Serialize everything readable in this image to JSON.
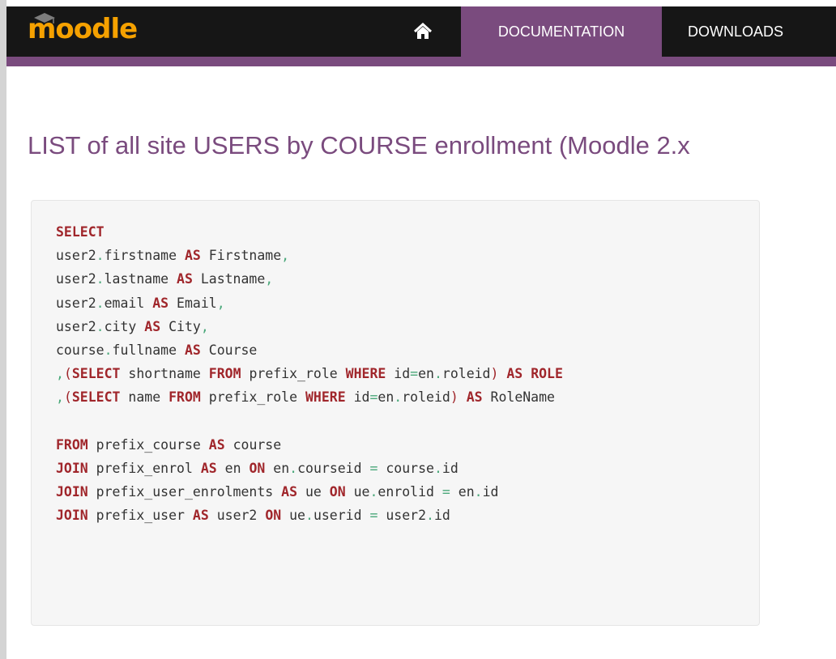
{
  "header": {
    "logo_text": "moodle",
    "nav": {
      "home_icon": "home-icon",
      "items": [
        {
          "label": "DOCUMENTATION",
          "active": true
        },
        {
          "label": "DOWNLOADS",
          "active": false
        }
      ]
    },
    "colors": {
      "bar": "#161616",
      "accent": "#7a4b7e",
      "logo": "#f5a100"
    }
  },
  "main": {
    "title": "LIST of all site USERS by COURSE enrollment (Moodle 2.x"
  },
  "code": {
    "language": "sql",
    "lines": [
      [
        {
          "t": "kw",
          "v": "SELECT"
        }
      ],
      [
        {
          "t": "tx",
          "v": "user2"
        },
        {
          "t": "pn",
          "v": "."
        },
        {
          "t": "tx",
          "v": "firstname "
        },
        {
          "t": "kw",
          "v": "AS"
        },
        {
          "t": "tx",
          "v": " Firstname"
        },
        {
          "t": "pn",
          "v": ","
        }
      ],
      [
        {
          "t": "tx",
          "v": "user2"
        },
        {
          "t": "pn",
          "v": "."
        },
        {
          "t": "tx",
          "v": "lastname "
        },
        {
          "t": "kw",
          "v": "AS"
        },
        {
          "t": "tx",
          "v": " Lastname"
        },
        {
          "t": "pn",
          "v": ","
        }
      ],
      [
        {
          "t": "tx",
          "v": "user2"
        },
        {
          "t": "pn",
          "v": "."
        },
        {
          "t": "tx",
          "v": "email "
        },
        {
          "t": "kw",
          "v": "AS"
        },
        {
          "t": "tx",
          "v": " Email"
        },
        {
          "t": "pn",
          "v": ","
        }
      ],
      [
        {
          "t": "tx",
          "v": "user2"
        },
        {
          "t": "pn",
          "v": "."
        },
        {
          "t": "tx",
          "v": "city "
        },
        {
          "t": "kw",
          "v": "AS"
        },
        {
          "t": "tx",
          "v": " City"
        },
        {
          "t": "pn",
          "v": ","
        }
      ],
      [
        {
          "t": "tx",
          "v": "course"
        },
        {
          "t": "pn",
          "v": "."
        },
        {
          "t": "tx",
          "v": "fullname "
        },
        {
          "t": "kw",
          "v": "AS"
        },
        {
          "t": "tx",
          "v": " Course"
        }
      ],
      [
        {
          "t": "pn",
          "v": ","
        },
        {
          "t": "pr",
          "v": "("
        },
        {
          "t": "kw",
          "v": "SELECT"
        },
        {
          "t": "tx",
          "v": " shortname "
        },
        {
          "t": "kw",
          "v": "FROM"
        },
        {
          "t": "tx",
          "v": " prefix_role "
        },
        {
          "t": "kw",
          "v": "WHERE"
        },
        {
          "t": "tx",
          "v": " id"
        },
        {
          "t": "pn",
          "v": "="
        },
        {
          "t": "tx",
          "v": "en"
        },
        {
          "t": "pn",
          "v": "."
        },
        {
          "t": "tx",
          "v": "roleid"
        },
        {
          "t": "pr",
          "v": ")"
        },
        {
          "t": "tx",
          "v": " "
        },
        {
          "t": "kw",
          "v": "AS"
        },
        {
          "t": "tx",
          "v": " "
        },
        {
          "t": "kw",
          "v": "ROLE"
        }
      ],
      [
        {
          "t": "pn",
          "v": ","
        },
        {
          "t": "pr",
          "v": "("
        },
        {
          "t": "kw",
          "v": "SELECT"
        },
        {
          "t": "tx",
          "v": " name "
        },
        {
          "t": "kw",
          "v": "FROM"
        },
        {
          "t": "tx",
          "v": " prefix_role "
        },
        {
          "t": "kw",
          "v": "WHERE"
        },
        {
          "t": "tx",
          "v": " id"
        },
        {
          "t": "pn",
          "v": "="
        },
        {
          "t": "tx",
          "v": "en"
        },
        {
          "t": "pn",
          "v": "."
        },
        {
          "t": "tx",
          "v": "roleid"
        },
        {
          "t": "pr",
          "v": ")"
        },
        {
          "t": "tx",
          "v": " "
        },
        {
          "t": "kw",
          "v": "AS"
        },
        {
          "t": "tx",
          "v": " RoleName"
        }
      ],
      [],
      [
        {
          "t": "kw",
          "v": "FROM"
        },
        {
          "t": "tx",
          "v": " prefix_course "
        },
        {
          "t": "kw",
          "v": "AS"
        },
        {
          "t": "tx",
          "v": " course"
        }
      ],
      [
        {
          "t": "kw",
          "v": "JOIN"
        },
        {
          "t": "tx",
          "v": " prefix_enrol "
        },
        {
          "t": "kw",
          "v": "AS"
        },
        {
          "t": "tx",
          "v": " en "
        },
        {
          "t": "kw",
          "v": "ON"
        },
        {
          "t": "tx",
          "v": " en"
        },
        {
          "t": "pn",
          "v": "."
        },
        {
          "t": "tx",
          "v": "courseid "
        },
        {
          "t": "pn",
          "v": "="
        },
        {
          "t": "tx",
          "v": " course"
        },
        {
          "t": "pn",
          "v": "."
        },
        {
          "t": "tx",
          "v": "id"
        }
      ],
      [
        {
          "t": "kw",
          "v": "JOIN"
        },
        {
          "t": "tx",
          "v": " prefix_user_enrolments "
        },
        {
          "t": "kw",
          "v": "AS"
        },
        {
          "t": "tx",
          "v": " ue "
        },
        {
          "t": "kw",
          "v": "ON"
        },
        {
          "t": "tx",
          "v": " ue"
        },
        {
          "t": "pn",
          "v": "."
        },
        {
          "t": "tx",
          "v": "enrolid "
        },
        {
          "t": "pn",
          "v": "="
        },
        {
          "t": "tx",
          "v": " en"
        },
        {
          "t": "pn",
          "v": "."
        },
        {
          "t": "tx",
          "v": "id"
        }
      ],
      [
        {
          "t": "kw",
          "v": "JOIN"
        },
        {
          "t": "tx",
          "v": " prefix_user "
        },
        {
          "t": "kw",
          "v": "AS"
        },
        {
          "t": "tx",
          "v": " user2 "
        },
        {
          "t": "kw",
          "v": "ON"
        },
        {
          "t": "tx",
          "v": " ue"
        },
        {
          "t": "pn",
          "v": "."
        },
        {
          "t": "tx",
          "v": "userid "
        },
        {
          "t": "pn",
          "v": "="
        },
        {
          "t": "tx",
          "v": " user2"
        },
        {
          "t": "pn",
          "v": "."
        },
        {
          "t": "tx",
          "v": "id"
        }
      ]
    ],
    "colors": {
      "keyword": "#a0262b",
      "punctuation": "#4aa87a",
      "paren": "#a0262b",
      "text": "#333333",
      "background": "#f6f6f6"
    }
  }
}
